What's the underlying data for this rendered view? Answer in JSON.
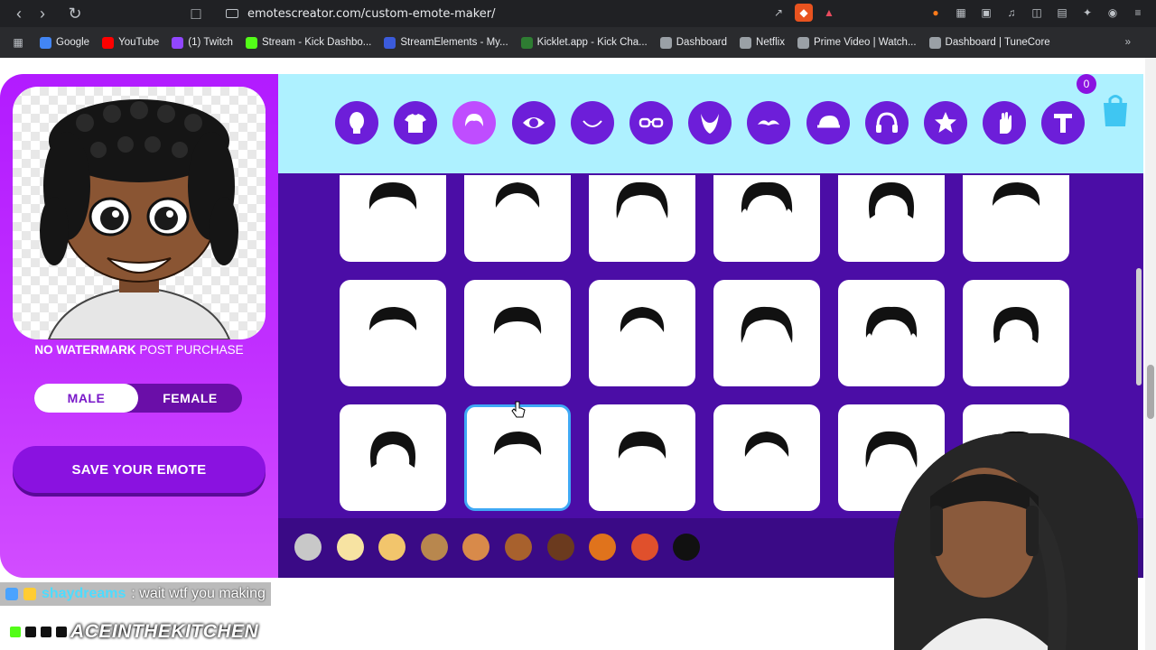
{
  "browser": {
    "url": "emotescreator.com/custom-emote-maker/",
    "bookmarks": [
      {
        "label": "Google",
        "color": "#4285f4"
      },
      {
        "label": "YouTube",
        "color": "#ff0000"
      },
      {
        "label": "(1) Twitch",
        "color": "#9146ff"
      },
      {
        "label": "Stream - Kick Dashbo...",
        "color": "#53fc18"
      },
      {
        "label": "StreamElements - My...",
        "color": "#3b5bdb"
      },
      {
        "label": "Kicklet.app - Kick Cha...",
        "color": "#2e7d32"
      },
      {
        "label": "Dashboard",
        "color": "#9aa0a6"
      },
      {
        "label": "Netflix",
        "color": "#9aa0a6"
      },
      {
        "label": "Prime Video | Watch...",
        "color": "#9aa0a6"
      },
      {
        "label": "Dashboard | TuneCore",
        "color": "#9aa0a6"
      }
    ]
  },
  "left": {
    "watermark_bold": "NO WATERMARK",
    "watermark_rest": " POST PURCHASE",
    "male_label": "MALE",
    "female_label": "FEMALE",
    "save_label": "SAVE YOUR EMOTE",
    "selected_gender": "male"
  },
  "categories": [
    {
      "name": "head-icon",
      "active": false
    },
    {
      "name": "shirt-icon",
      "active": false
    },
    {
      "name": "hair-icon",
      "active": true
    },
    {
      "name": "eye-icon",
      "active": false
    },
    {
      "name": "mouth-icon",
      "active": false
    },
    {
      "name": "glasses-icon",
      "active": false
    },
    {
      "name": "beard-icon",
      "active": false
    },
    {
      "name": "mustache-icon",
      "active": false
    },
    {
      "name": "cap-icon",
      "active": false
    },
    {
      "name": "headphones-icon",
      "active": false
    },
    {
      "name": "star-icon",
      "active": false
    },
    {
      "name": "hand-icon",
      "active": false
    },
    {
      "name": "text-icon",
      "active": false
    }
  ],
  "cart": {
    "count": "0"
  },
  "hair_grid": {
    "selected_index": 13,
    "count": 18
  },
  "swatches": [
    "#c8c8c8",
    "#f7e3a2",
    "#f2c56c",
    "#b8874e",
    "#d88a4a",
    "#a8612d",
    "#6b3a1e",
    "#e0731c",
    "#e0502c",
    "#111111"
  ],
  "colors": {
    "accent": "#b21bff",
    "panel": "#4b0da6",
    "category_bar": "#aef1ff",
    "selected_border": "#3fa9f5"
  },
  "chat": {
    "user": "shaydreams",
    "message": ": wait wtf you making"
  },
  "streamer": {
    "name": "ACEINTHEKITCHEN"
  }
}
